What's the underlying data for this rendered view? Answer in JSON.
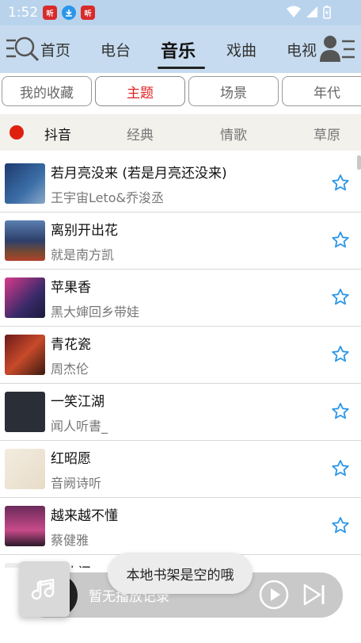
{
  "status": {
    "time": "1:52",
    "app_icons": [
      "红色应用图标",
      "蓝色下载图标",
      "红色应用图标"
    ],
    "indicators": [
      "wifi-icon",
      "signal-icon",
      "battery-icon"
    ]
  },
  "nav": {
    "tabs": [
      {
        "label": "首页",
        "active": false
      },
      {
        "label": "电台",
        "active": false
      },
      {
        "label": "音乐",
        "active": true
      },
      {
        "label": "戏曲",
        "active": false
      },
      {
        "label": "电视",
        "active": false
      }
    ]
  },
  "subtabs": [
    {
      "label": "我的收藏",
      "active": false
    },
    {
      "label": "主题",
      "active": true
    },
    {
      "label": "场景",
      "active": false
    },
    {
      "label": "年代",
      "active": false
    }
  ],
  "categories": [
    {
      "label": "抖音",
      "active": true
    },
    {
      "label": "经典",
      "active": false
    },
    {
      "label": "情歌",
      "active": false
    },
    {
      "label": "草原",
      "active": false
    }
  ],
  "songs": [
    {
      "title": "若月亮没来 (若是月亮还没来)",
      "artist": "王宇宙Leto&乔浚丞"
    },
    {
      "title": "离别开出花",
      "artist": "就是南方凯"
    },
    {
      "title": "苹果香",
      "artist": "黑大婶回乡带娃"
    },
    {
      "title": "青花瓷",
      "artist": "周杰伦"
    },
    {
      "title": "一笑江湖",
      "artist": "闻人听書_"
    },
    {
      "title": "红昭愿",
      "artist": "音阙诗听"
    },
    {
      "title": "越来越不懂",
      "artist": "蔡健雅"
    },
    {
      "title": "凑热闹",
      "artist": ""
    }
  ],
  "player": {
    "text": "暂无播放记录"
  },
  "toast": {
    "text": "本地书架是空的哦"
  },
  "colors": {
    "accent": "#2a96e8",
    "active_red": "#e02020",
    "nav_bg": "#c6dbef"
  }
}
